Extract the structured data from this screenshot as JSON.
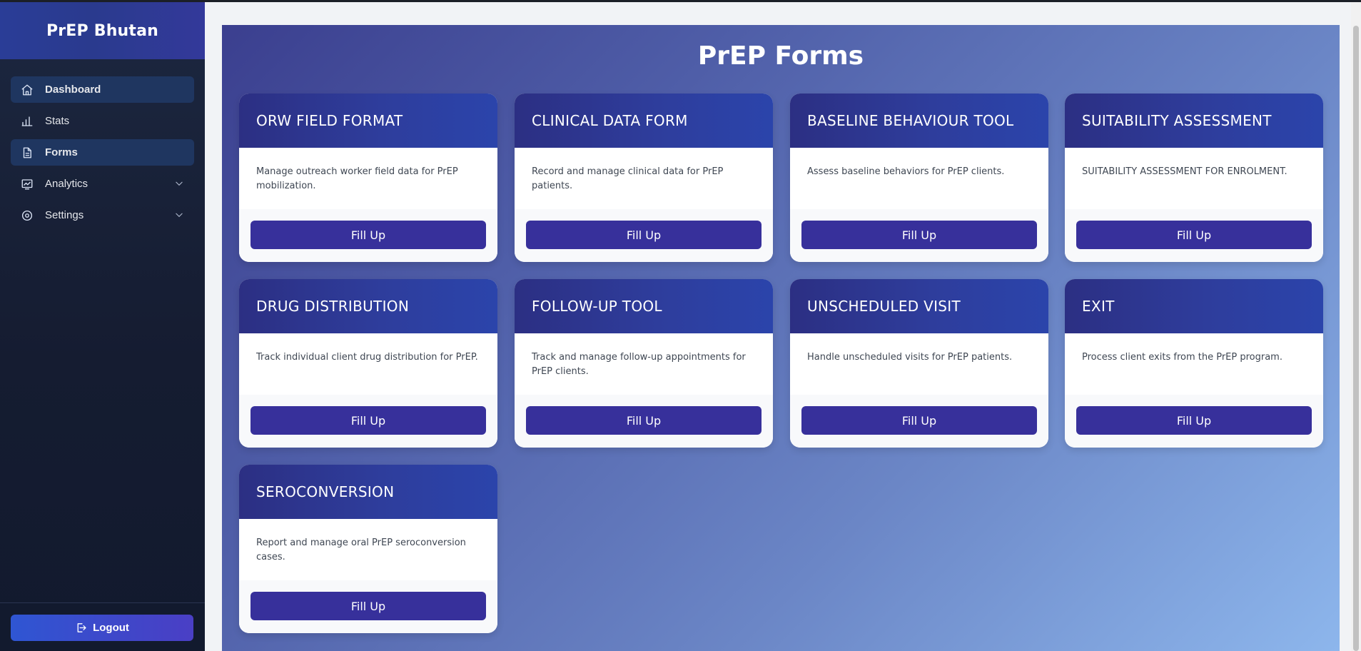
{
  "app": {
    "brand": "PrEP Bhutan"
  },
  "sidebar": {
    "items": [
      {
        "label": "Dashboard",
        "icon": "home-icon"
      },
      {
        "label": "Stats",
        "icon": "bar-chart-icon"
      },
      {
        "label": "Forms",
        "icon": "document-icon"
      },
      {
        "label": "Analytics",
        "icon": "line-chart-icon"
      },
      {
        "label": "Settings",
        "icon": "gear-icon"
      }
    ],
    "logout_label": "Logout"
  },
  "main": {
    "title": "PrEP Forms",
    "cards": [
      {
        "title": "ORW FIELD FORMAT",
        "description": "Manage outreach worker field data for PrEP mobilization.",
        "button": "Fill Up"
      },
      {
        "title": "CLINICAL DATA FORM",
        "description": "Record and manage clinical data for PrEP patients.",
        "button": "Fill Up"
      },
      {
        "title": "BASELINE BEHAVIOUR TOOL",
        "description": "Assess baseline behaviors for PrEP clients.",
        "button": "Fill Up"
      },
      {
        "title": "SUITABILITY ASSESSMENT",
        "description": "SUITABILITY ASSESSMENT FOR ENROLMENT.",
        "button": "Fill Up"
      },
      {
        "title": "DRUG DISTRIBUTION",
        "description": "Track individual client drug distribution for PrEP.",
        "button": "Fill Up"
      },
      {
        "title": "FOLLOW-UP TOOL",
        "description": "Track and manage follow-up appointments for PrEP clients.",
        "button": "Fill Up"
      },
      {
        "title": "UNSCHEDULED VISIT",
        "description": "Handle unscheduled visits for PrEP patients.",
        "button": "Fill Up"
      },
      {
        "title": "EXIT",
        "description": "Process client exits from the PrEP program.",
        "button": "Fill Up"
      },
      {
        "title": "SEROCONVERSION",
        "description": "Report and manage oral PrEP seroconversion cases.",
        "button": "Fill Up"
      }
    ]
  },
  "colors": {
    "sidebar_bg": "#151c31",
    "active_item_bg": "#1f3660",
    "button": "#37309b",
    "card_header": "#2e3d9c"
  }
}
